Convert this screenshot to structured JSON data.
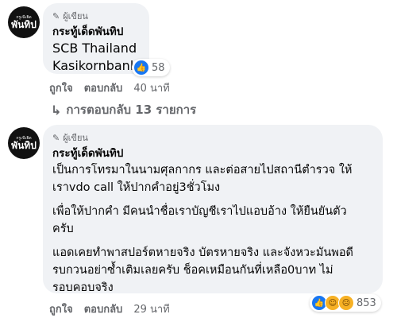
{
  "comments": [
    {
      "avatar_lines": [
        "กรูเจ๊ะยิด",
        "พันทิป"
      ],
      "badge_label": "ผู้เขียน",
      "author": "กระทู้เด็ดพันทิป",
      "body": "SCB Thailand\nKasikornbank",
      "reaction_count": "58",
      "reaction_icons": [
        "like-icon"
      ],
      "actions": {
        "like": "ถูกใจ",
        "reply": "ตอบกลับ",
        "time": "40 นาที"
      },
      "replies_label": "การตอบกลับ 13 รายการ"
    },
    {
      "avatar_lines": [
        "กรูเจ๊ะยิด",
        "พันทิป"
      ],
      "badge_label": "ผู้เขียน",
      "author": "กระทู้เด็ดพันทิป",
      "paragraphs": [
        "เป็นการโทรมาในนามศุลกากร และต่อสายไปสถานีตำรวจ ให้\nเราvdo call ให้ปากคำอยู่3ชั่วโมง",
        "เพื่อให้ปากคำ มีคนนำชื่อเราบัญชีเราไปแอบอ้าง ให้ยืนยันตัว\nครับ",
        "แอดเคยทำพาสปอร์ตหายจริง บัตรหายจริง และจังหวะมันพอดี\nรบกวนอย่าซ้ำเติมเลยครับ ช็อคเหมือนกันที่เหลือ0บาท ไม่\nรอบคอบจริง"
      ],
      "reaction_count": "853",
      "reaction_icons": [
        "like-icon",
        "haha-icon",
        "sad-icon"
      ],
      "actions": {
        "like": "ถูกใจ",
        "reply": "ตอบกลับ",
        "time": "29 นาที"
      }
    }
  ],
  "colors": {
    "bubble": "#f0f2f5",
    "secondary_text": "#65676b",
    "like_blue": "#1877f2"
  }
}
